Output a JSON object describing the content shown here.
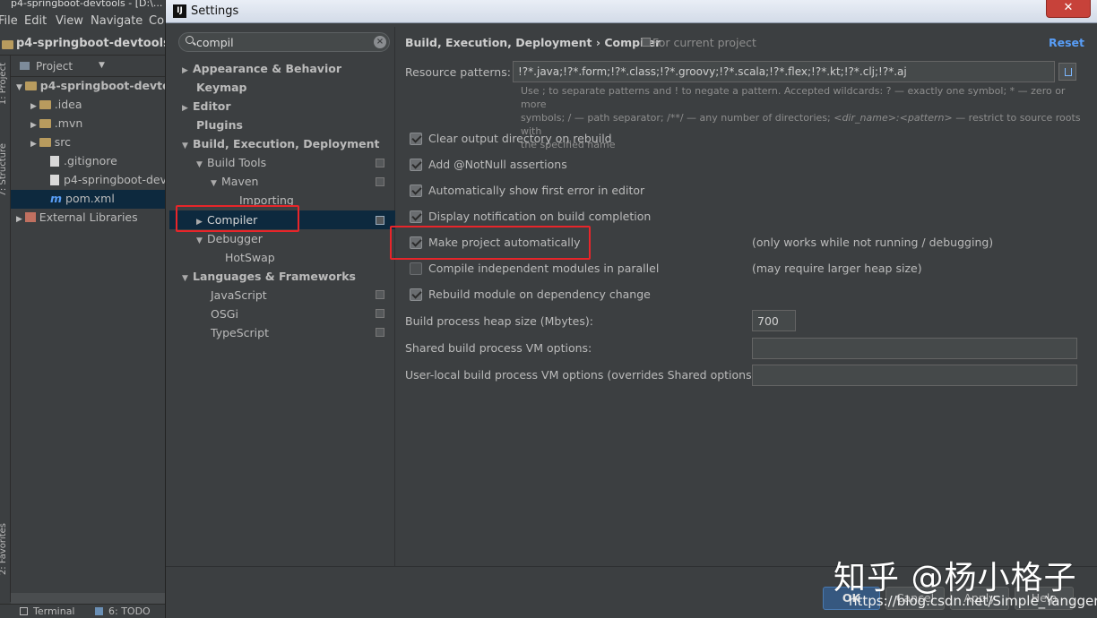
{
  "ide": {
    "window_title": "p4-springboot-devtools - [D:\\...",
    "menu": [
      "File",
      "Edit",
      "View",
      "Navigate",
      "Co"
    ],
    "project_name": "p4-springboot-devtools",
    "panel_title": "Project",
    "vertical_tabs": {
      "project": "1: Project",
      "structure": "7: Structure",
      "favorites": "2: Favorites"
    },
    "tree": [
      {
        "label": "p4-springboot-devto",
        "kind": "folder"
      },
      {
        "label": ".idea",
        "kind": "folder"
      },
      {
        "label": ".mvn",
        "kind": "folder"
      },
      {
        "label": "src",
        "kind": "folder"
      },
      {
        "label": ".gitignore",
        "kind": "file"
      },
      {
        "label": "p4-springboot-dev",
        "kind": "file"
      },
      {
        "label": "pom.xml",
        "kind": "maven"
      },
      {
        "label": "External Libraries",
        "kind": "library"
      }
    ],
    "bottom_tabs": [
      "Terminal",
      "6: TODO"
    ]
  },
  "dialog": {
    "title": "Settings",
    "search": {
      "value": "compil",
      "placeholder": ""
    },
    "nav": [
      {
        "label": "Appearance & Behavior",
        "bold": true,
        "toggle": "▶"
      },
      {
        "label": "Keymap",
        "bold": true,
        "toggle": ""
      },
      {
        "label": "Editor",
        "bold": true,
        "toggle": "▶"
      },
      {
        "label": "Plugins",
        "bold": true,
        "toggle": ""
      },
      {
        "label": "Build, Execution, Deployment",
        "bold": true,
        "toggle": "▼"
      },
      {
        "label": "Build Tools",
        "bold": false,
        "toggle": "▼"
      },
      {
        "label": "Maven",
        "bold": false,
        "toggle": "▼"
      },
      {
        "label": "Importing",
        "bold": false,
        "toggle": ""
      },
      {
        "label": "Compiler",
        "bold": false,
        "toggle": "▶",
        "selected": true
      },
      {
        "label": "Debugger",
        "bold": false,
        "toggle": "▼"
      },
      {
        "label": "HotSwap",
        "bold": false,
        "toggle": ""
      },
      {
        "label": "Languages & Frameworks",
        "bold": true,
        "toggle": "▼"
      },
      {
        "label": "JavaScript",
        "bold": false,
        "toggle": ""
      },
      {
        "label": "OSGi",
        "bold": false,
        "toggle": ""
      },
      {
        "label": "TypeScript",
        "bold": false,
        "toggle": ""
      }
    ],
    "breadcrumb": "Build, Execution, Deployment › Compiler",
    "scope": "For current project",
    "reset": "Reset",
    "resource_label": "Resource patterns:",
    "resource_value": "!?*.java;!?*.form;!?*.class;!?*.groovy;!?*.scala;!?*.flex;!?*.kt;!?*.clj;!?*.aj",
    "hint_1": "Use ; to separate patterns and ! to negate a pattern. Accepted wildcards: ? — exactly one symbol; * — zero or more",
    "hint_2": "symbols; / — path separator; /**/ — any number of directories;",
    "hint_3": "<dir_name>:<pattern>",
    "hint_4": "— restrict to source roots with",
    "hint_5": "the specified name",
    "options": [
      {
        "label": "Clear output directory on rebuild",
        "checked": true,
        "note": ""
      },
      {
        "label": "Add @NotNull assertions",
        "checked": true,
        "note": ""
      },
      {
        "label": "Automatically show first error in editor",
        "checked": true,
        "note": ""
      },
      {
        "label": "Display notification on build completion",
        "checked": true,
        "note": ""
      },
      {
        "label": "Make project automatically",
        "checked": true,
        "note": "(only works while not running / debugging)"
      },
      {
        "label": "Compile independent modules in parallel",
        "checked": false,
        "note": "(may require larger heap size)"
      },
      {
        "label": "Rebuild module on dependency change",
        "checked": true,
        "note": ""
      }
    ],
    "heap_label": "Build process heap size (Mbytes):",
    "heap_value": "700",
    "shared_label": "Shared build process VM options:",
    "shared_value": "",
    "local_label": "User-local build process VM options (overrides Shared options):",
    "local_value": "",
    "buttons": {
      "ok": "OK",
      "cancel": "Cancel",
      "apply": "Apply",
      "help": "Help"
    }
  },
  "watermark": {
    "main": "知乎 @杨小格子",
    "url": "https://blog.csdn.net/Simple_Yangger"
  },
  "colors": {
    "background": "#3c3f41",
    "selection": "#0d293e",
    "link": "#589df6",
    "highlight": "#e8252a"
  }
}
